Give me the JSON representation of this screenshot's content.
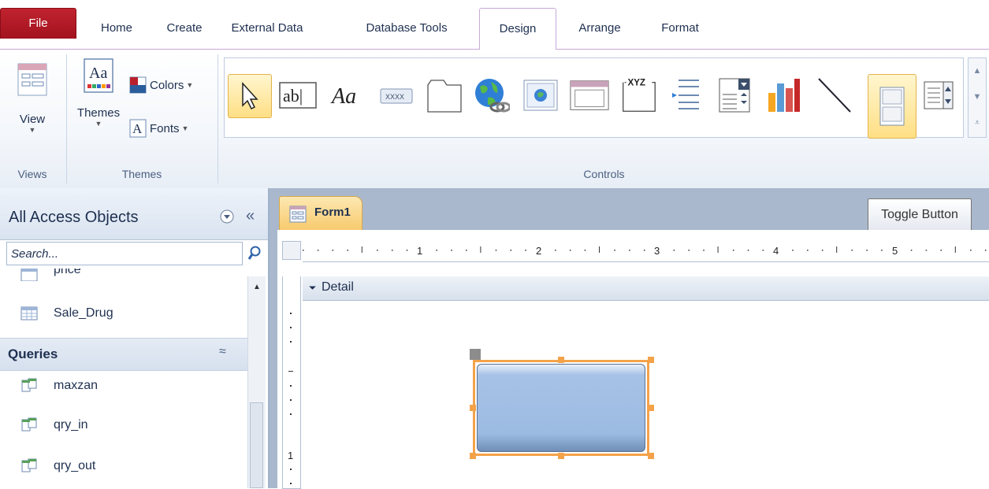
{
  "tabs": {
    "file": "File",
    "home": "Home",
    "create": "Create",
    "external_data": "External Data",
    "database_tools": "Database Tools",
    "design": "Design",
    "arrange": "Arrange",
    "format": "Format"
  },
  "ribbon": {
    "views": {
      "view_label": "View",
      "group_label": "Views"
    },
    "themes": {
      "themes_label": "Themes",
      "colors_label": "Colors",
      "fonts_label": "Fonts",
      "group_label": "Themes"
    },
    "controls": {
      "group_label": "Controls",
      "items": [
        "select-icon",
        "textbox-icon",
        "label-icon",
        "button-icon",
        "tab-control-icon",
        "hyperlink-icon",
        "web-browser-icon",
        "navigation-control-icon",
        "option-group-icon",
        "page-break-icon",
        "combo-box-icon",
        "chart-icon",
        "line-icon",
        "toggle-button-icon",
        "list-box-icon"
      ],
      "selected": "toggle-button-icon",
      "xyz_text": "XYZ",
      "xxxx_text": "XXXX",
      "ab_text": "ab|",
      "aa_text": "Aa"
    }
  },
  "nav": {
    "title": "All Access Objects",
    "search_placeholder": "Search...",
    "items_top": [
      "price",
      "Sale_Drug"
    ],
    "queries_header": "Queries",
    "queries": [
      "maxzan",
      "qry_in",
      "qry_out"
    ]
  },
  "document": {
    "tab_label": "Form1",
    "tooltip": "Toggle Button",
    "detail_label": "Detail",
    "ruler_numbers": [
      "1",
      "2",
      "3",
      "4",
      "5"
    ],
    "vertical_ruler_number": "1"
  },
  "colors": {
    "file_tab": "#b8202c",
    "accent": "#f4a24a",
    "toggle_fill": "#9fbce0"
  }
}
